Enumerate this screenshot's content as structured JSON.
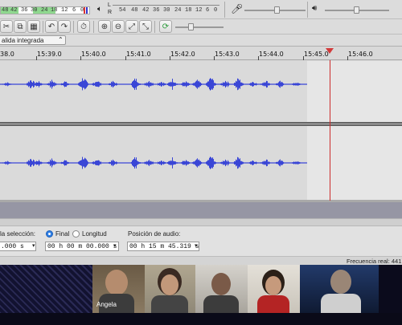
{
  "meters": {
    "record_ticks": [
      "48",
      "42",
      "36",
      "30",
      "24",
      "18",
      "12",
      "6",
      "0"
    ],
    "play_ticks": [
      "54",
      "48",
      "42",
      "36",
      "30",
      "24",
      "18",
      "12",
      "6",
      "0"
    ],
    "play_channel_l": "L",
    "play_channel_r": "R"
  },
  "toolbar": {
    "output_device": "alida integrada"
  },
  "ruler": {
    "labels": [
      "38.0",
      "15:39.0",
      "15:40.0",
      "15:41.0",
      "15:42.0",
      "15:43.0",
      "15:44.0",
      "15:45.0",
      "15:46.0"
    ]
  },
  "selection_toolbar": {
    "selection_label": "la selección:",
    "radio_final": "Final",
    "radio_length": "Longitud",
    "audio_position_label": "Posición de audio:",
    "sel_start_value": ".000 s",
    "sel_end_value": "00 h 00 m 00.000 s",
    "audio_position_value": "00 h 15 m 45.319 s"
  },
  "status": {
    "rate_text": "Frecuencia real: 441"
  },
  "video_call": {
    "participant_name": "Angela"
  },
  "colors": {
    "waveform": "#3a46d6",
    "playhead": "#cc2b2b",
    "radio_active": "#2f7fe5"
  }
}
